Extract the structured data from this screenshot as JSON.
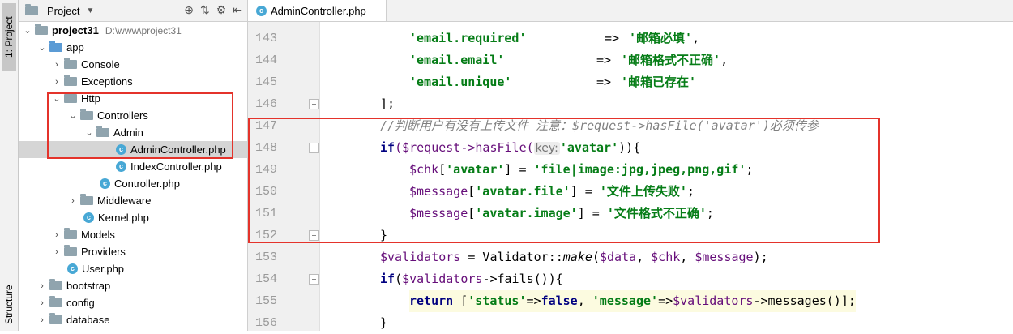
{
  "toolwindow": {
    "project_tab": "1: Project",
    "structure_tab": "Structure"
  },
  "project_panel": {
    "title": "Project",
    "tree": [
      {
        "label": "project31",
        "path": "D:\\www\\project31"
      },
      {
        "label": "app"
      },
      {
        "label": "Console"
      },
      {
        "label": "Exceptions"
      },
      {
        "label": "Http"
      },
      {
        "label": "Controllers"
      },
      {
        "label": "Admin"
      },
      {
        "label": "AdminController.php"
      },
      {
        "label": "IndexController.php"
      },
      {
        "label": "Controller.php"
      },
      {
        "label": "Middleware"
      },
      {
        "label": "Kernel.php"
      },
      {
        "label": "Models"
      },
      {
        "label": "Providers"
      },
      {
        "label": "User.php"
      },
      {
        "label": "bootstrap"
      },
      {
        "label": "config"
      },
      {
        "label": "database"
      }
    ]
  },
  "editor": {
    "tab_label": "AdminController.php",
    "hint": "key:",
    "lines": [
      {
        "n": "143",
        "s": "'email.required'",
        "arrow": "=>",
        "v": "'邮箱必填'",
        "end": ","
      },
      {
        "n": "144",
        "s": "'email.email'",
        "arrow": "=>",
        "v": "'邮箱格式不正确'",
        "end": ","
      },
      {
        "n": "145",
        "s": "'email.unique'",
        "arrow": "=>",
        "v": "'邮箱已存在'",
        "end": ""
      },
      {
        "n": "146",
        "t": "];"
      },
      {
        "n": "147",
        "c": "//判断用户有没有上传文件 注意：$request->hasFile('avatar')必须传参"
      },
      {
        "n": "148"
      },
      {
        "n": "149"
      },
      {
        "n": "150"
      },
      {
        "n": "151"
      },
      {
        "n": "152",
        "t": "}"
      },
      {
        "n": "153"
      },
      {
        "n": "154"
      },
      {
        "n": "155"
      },
      {
        "n": "156",
        "t": "}"
      }
    ],
    "t148": {
      "kw": "if",
      "a": "($request->hasFile(",
      "s": "'avatar'",
      "b": ")){"
    },
    "t149": {
      "v": "$chk",
      "a": "[",
      "s1": "'avatar'",
      "b": "] = ",
      "s2": "'file|image:jpg,jpeg,png,gif'",
      "c": ";"
    },
    "t150": {
      "v": "$message",
      "a": "[",
      "s1": "'avatar.file'",
      "b": "] = ",
      "s2": "'文件上传失败'",
      "c": ";"
    },
    "t151": {
      "v": "$message",
      "a": "[",
      "s1": "'avatar.image'",
      "b": "] = ",
      "s2": "'文件格式不正确'",
      "c": ";"
    },
    "t153": {
      "v": "$validators",
      "a": " = Validator::",
      "m": "make",
      "b": "(",
      "v2": "$data",
      "c": ", ",
      "v3": "$chk",
      "d": ", ",
      "v4": "$message",
      "e": ");"
    },
    "t154": {
      "kw": "if",
      "a": "(",
      "v": "$validators",
      "b": "->fails()){"
    },
    "t155": {
      "kw": "return",
      "a": " [",
      "s1": "'status'",
      "b": "=>",
      "kw2": "false",
      "c": ", ",
      "s2": "'message'",
      "d": "=>",
      "v": "$validators",
      "e": "->messages()];"
    }
  },
  "colors": {
    "annotation_box": "#e4332b",
    "string": "#067d17",
    "variable": "#660e7a",
    "keyword": "#000080",
    "comment": "#808080"
  }
}
